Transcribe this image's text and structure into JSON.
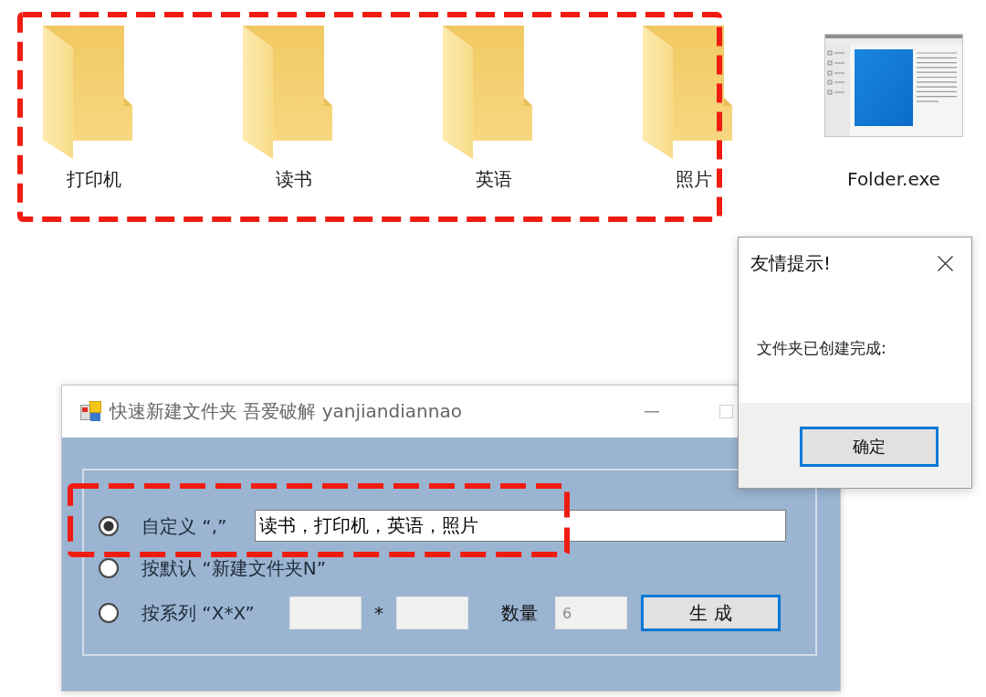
{
  "desktop": {
    "items": [
      {
        "kind": "folder",
        "name": "打印机",
        "highlighted": true
      },
      {
        "kind": "folder",
        "name": "读书",
        "highlighted": true
      },
      {
        "kind": "folder",
        "name": "英语",
        "highlighted": true
      },
      {
        "kind": "folder",
        "name": "照片",
        "highlighted": true
      },
      {
        "kind": "app",
        "name": "Folder.exe",
        "highlighted": false
      }
    ]
  },
  "app_window": {
    "title": "快速新建文件夹 吾爱破解 yanjiandiannao",
    "options": [
      {
        "kind": "text",
        "label": "自定义 “,”",
        "selected": true,
        "highlighted": true,
        "field": {
          "value": "读书，打印机，英语，照片",
          "disabled": false
        }
      },
      {
        "kind": "plain",
        "label": "按默认 “新建文件夹N”",
        "selected": false,
        "highlighted": false
      },
      {
        "kind": "series",
        "label": "按系列 “X*X”",
        "selected": false,
        "highlighted": false,
        "fields": [
          {
            "disabled": true
          },
          {
            "disabled": true
          }
        ],
        "separator": "*",
        "count_label": "数量",
        "count_field": {
          "value": "6",
          "disabled": true
        },
        "button": {
          "label": "生 成",
          "focused": true
        }
      }
    ]
  },
  "dialog": {
    "title": "友情提示!",
    "message": "文件夹已创建完成:",
    "button": {
      "label": "确定",
      "focused": true
    }
  }
}
